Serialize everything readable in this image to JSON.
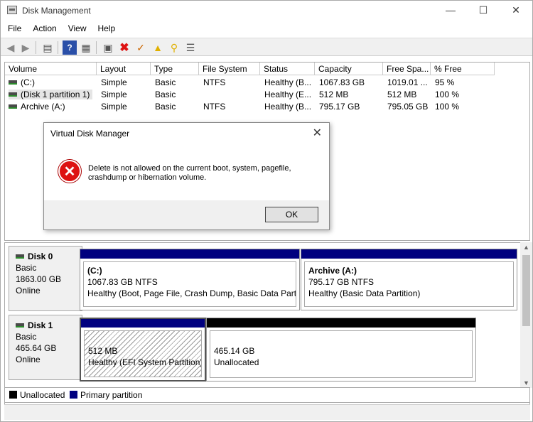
{
  "window": {
    "title": "Disk Management",
    "icon": "disk-management-icon"
  },
  "menu": [
    "File",
    "Action",
    "View",
    "Help"
  ],
  "columns": [
    "Volume",
    "Layout",
    "Type",
    "File System",
    "Status",
    "Capacity",
    "Free Spa...",
    "% Free"
  ],
  "volumes": [
    {
      "volume": "(C:)",
      "layout": "Simple",
      "type": "Basic",
      "fs": "NTFS",
      "status": "Healthy (B...",
      "capacity": "1067.83 GB",
      "free": "1019.01 ...",
      "pct": "95 %"
    },
    {
      "volume": "(Disk 1 partition 1)",
      "layout": "Simple",
      "type": "Basic",
      "fs": "",
      "status": "Healthy (E...",
      "capacity": "512 MB",
      "free": "512 MB",
      "pct": "100 %"
    },
    {
      "volume": "Archive (A:)",
      "layout": "Simple",
      "type": "Basic",
      "fs": "NTFS",
      "status": "Healthy (B...",
      "capacity": "795.17 GB",
      "free": "795.05 GB",
      "pct": "100 %"
    }
  ],
  "dialog": {
    "title": "Virtual Disk Manager",
    "message": "Delete is not allowed on the current boot, system, pagefile, crashdump or hibernation volume.",
    "ok": "OK"
  },
  "disks": [
    {
      "name": "Disk 0",
      "type": "Basic",
      "size": "1863.00 GB",
      "state": "Online",
      "parts": [
        {
          "label": "(C:)",
          "size": "1067.83 GB NTFS",
          "status": "Healthy (Boot, Page File, Crash Dump, Basic Data Partitio"
        },
        {
          "label": "Archive  (A:)",
          "size": "795.17 GB NTFS",
          "status": "Healthy (Basic Data Partition)"
        }
      ]
    },
    {
      "name": "Disk 1",
      "type": "Basic",
      "size": "465.64 GB",
      "state": "Online",
      "parts": [
        {
          "label": "",
          "size": "512 MB",
          "status": "Healthy (EFI System Partition)"
        },
        {
          "label": "",
          "size": "465.14 GB",
          "status": "Unallocated"
        }
      ]
    }
  ],
  "legend": {
    "unallocated": "Unallocated",
    "primary": "Primary partition"
  },
  "colors": {
    "primary": "#00007f",
    "unallocated": "#000000"
  }
}
